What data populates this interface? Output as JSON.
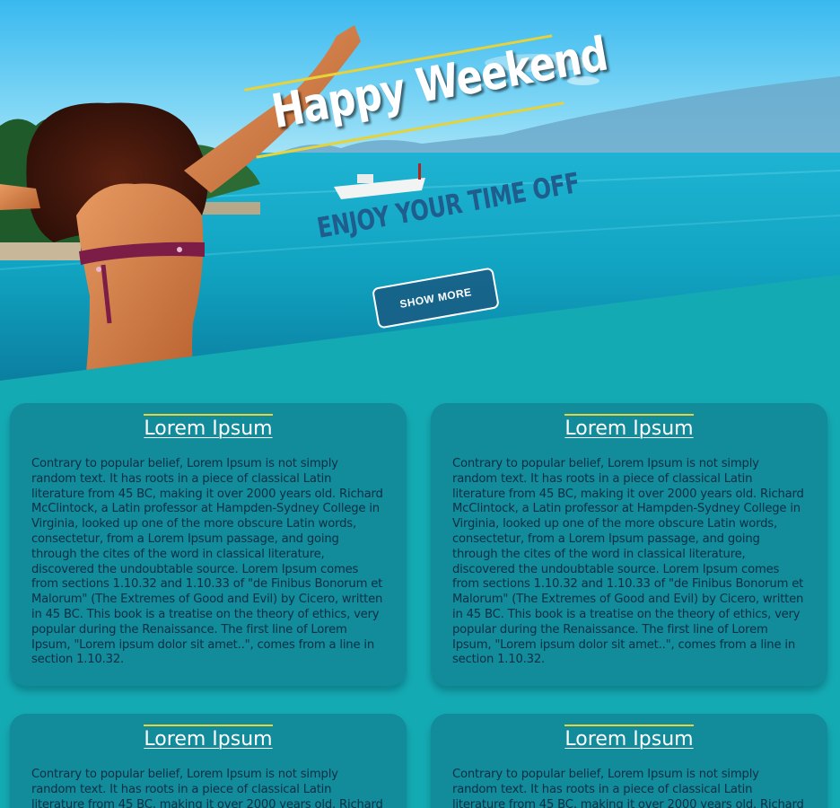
{
  "hero": {
    "title": "Happy Weekend",
    "subtitle": "ENJOY YOUR TIME OFF",
    "button_label": "SHOW MORE"
  },
  "cards": [
    {
      "title": "Lorem Ipsum",
      "text": "Contrary to popular belief, Lorem Ipsum is not simply random text. It has roots in a piece of classical Latin literature from 45 BC, making it over 2000 years old. Richard McClintock, a Latin professor at Hampden-Sydney College in Virginia, looked up one of the more obscure Latin words, consectetur, from a Lorem Ipsum passage, and going through the cites of the word in classical literature, discovered the undoubtable source. Lorem Ipsum comes from sections 1.10.32 and 1.10.33 of \"de Finibus Bonorum et Malorum\" (The Extremes of Good and Evil) by Cicero, written in 45 BC. This book is a treatise on the theory of ethics, very popular during the Renaissance. The first line of Lorem Ipsum, \"Lorem ipsum dolor sit amet..\", comes from a line in section 1.10.32."
    },
    {
      "title": "Lorem Ipsum",
      "text": "Contrary to popular belief, Lorem Ipsum is not simply random text. It has roots in a piece of classical Latin literature from 45 BC, making it over 2000 years old. Richard McClintock, a Latin professor at Hampden-Sydney College in Virginia, looked up one of the more obscure Latin words, consectetur, from a Lorem Ipsum passage, and going through the cites of the word in classical literature, discovered the undoubtable source. Lorem Ipsum comes from sections 1.10.32 and 1.10.33 of \"de Finibus Bonorum et Malorum\" (The Extremes of Good and Evil) by Cicero, written in 45 BC. This book is a treatise on the theory of ethics, very popular during the Renaissance. The first line of Lorem Ipsum, \"Lorem ipsum dolor sit amet..\", comes from a line in section 1.10.32."
    },
    {
      "title": "Lorem Ipsum",
      "text": "Contrary to popular belief, Lorem Ipsum is not simply random text. It has roots in a piece of classical Latin literature from 45 BC, making it over 2000 years old. Richard"
    },
    {
      "title": "Lorem Ipsum",
      "text": "Contrary to popular belief, Lorem Ipsum is not simply random text. It has roots in a piece of classical Latin literature from 45 BC, making it over 2000 years old. Richard"
    }
  ],
  "colors": {
    "page_background": "#14aab4",
    "card_background": "#128b9b",
    "accent_yellow": "#e6d23a",
    "subtitle_blue": "#1f5d8c",
    "body_text": "#0b2f45"
  }
}
